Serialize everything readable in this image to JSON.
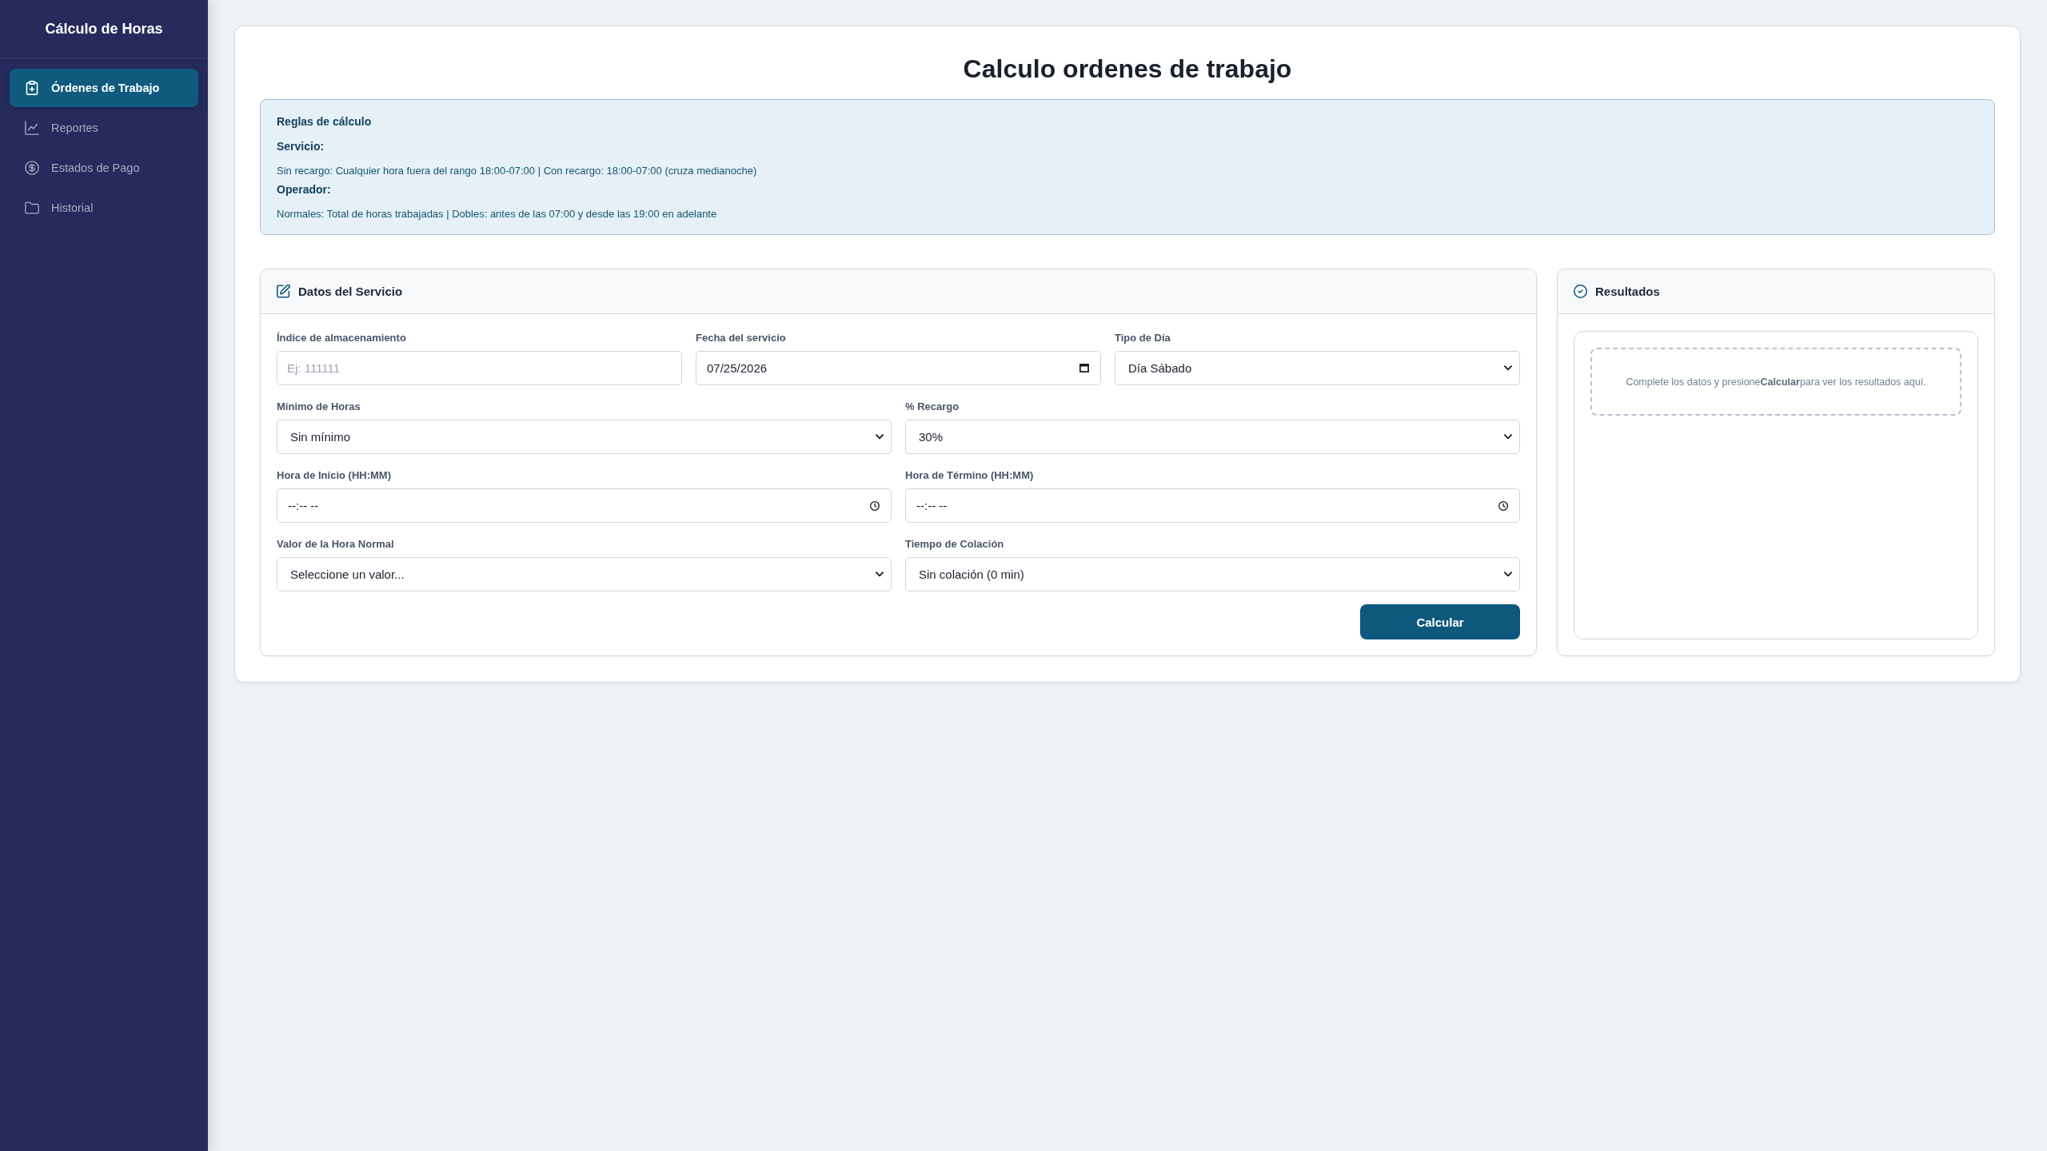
{
  "sidebar": {
    "title": "Cálculo de Horas",
    "items": [
      {
        "label": "Órdenes de Trabajo",
        "selected": true
      },
      {
        "label": "Reportes",
        "selected": false
      },
      {
        "label": "Estados de Pago",
        "selected": false
      },
      {
        "label": "Historial",
        "selected": false
      }
    ]
  },
  "page": {
    "title": "Calculo ordenes de trabajo"
  },
  "rules": {
    "title": "Reglas de cálculo",
    "sections": [
      {
        "heading": "Servicio:",
        "text": "Sin recargo: Cualquier hora fuera del rango 18:00-07:00 | Con recargo: 18:00-07:00 (cruza medianoche)"
      },
      {
        "heading": "Operador:",
        "text": "Normales: Total de horas trabajadas | Dobles: antes de las 07:00 y desde las 19:00 en adelante"
      }
    ]
  },
  "service_form": {
    "title": "Datos del Servicio",
    "rows": [
      {
        "fields": [
          {
            "kind": "text",
            "label": "Índice de almacenamiento",
            "placeholder": "Ej: 111111"
          },
          {
            "kind": "date",
            "label": "Fecha del servicio",
            "value": "07/25/2026"
          },
          {
            "kind": "select",
            "label": "Tipo de Día",
            "value": "Día Sábado"
          }
        ]
      },
      {
        "fields": [
          {
            "kind": "select",
            "label": "Mínimo de Horas",
            "value": "Sin mínimo"
          },
          {
            "kind": "select",
            "label": "% Recargo",
            "value": "30%"
          }
        ]
      },
      {
        "fields": [
          {
            "kind": "time",
            "label": "Hora de Inicio (HH:MM)",
            "value": "--:-- --"
          },
          {
            "kind": "time",
            "label": "Hora de Término (HH:MM)",
            "value": "--:-- --"
          }
        ]
      },
      {
        "fields": [
          {
            "kind": "select",
            "label": "Valor de la Hora Normal",
            "value": "Seleccione un valor..."
          },
          {
            "kind": "select",
            "label": "Tiempo de Colación",
            "value": "Sin colación (0 min)"
          }
        ]
      }
    ],
    "button": "Calcular"
  },
  "results": {
    "title": "Resultados",
    "message": "Complete los datos y presione**Calcular**para ver los resultados aquí."
  }
}
